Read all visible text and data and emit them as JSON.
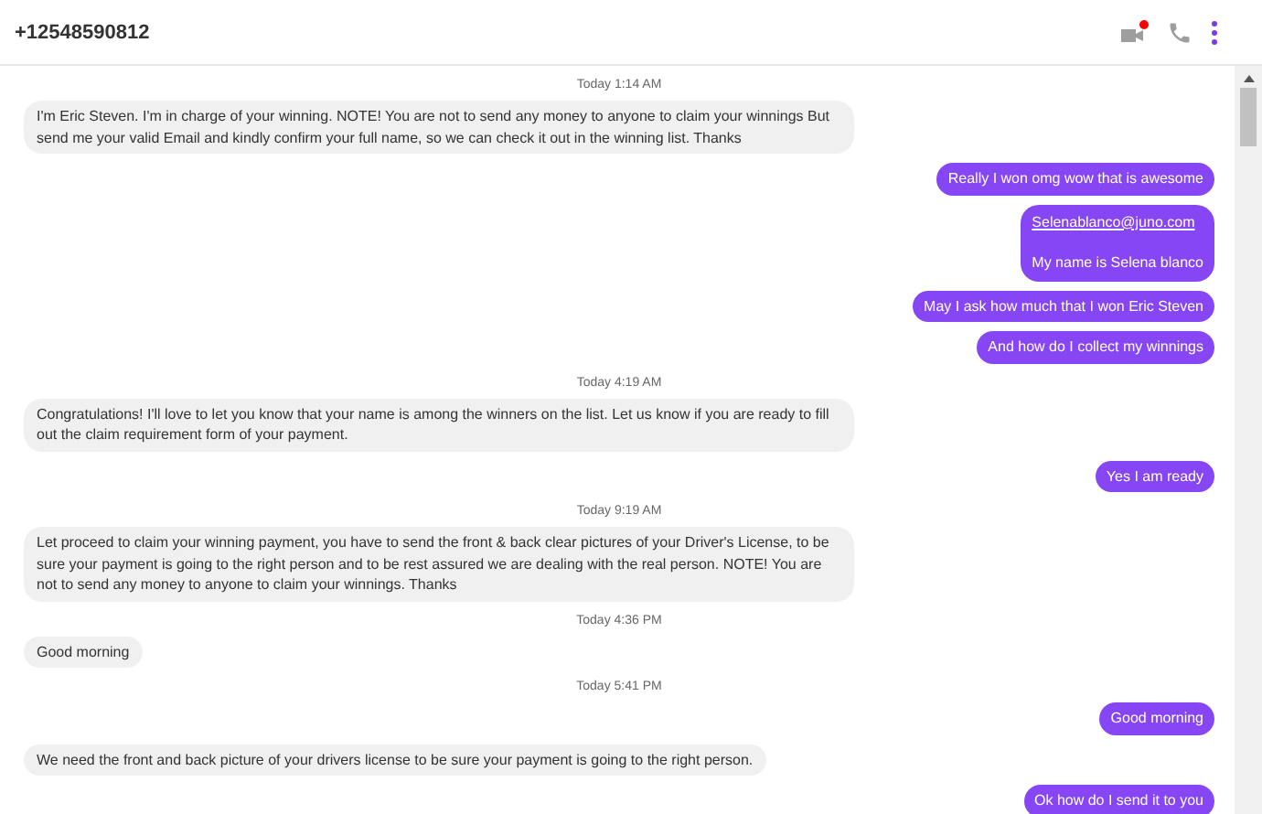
{
  "header": {
    "title": "+12548590812",
    "video_notification": true
  },
  "messages": [
    {
      "kind": "time",
      "text": "Today 1:14 AM"
    },
    {
      "kind": "in",
      "text": "I'm Eric Steven. I'm in charge of your winning. NOTE! You are not to send any money to anyone to claim your winnings But send me your valid Email and kindly confirm your full name, so we can check it out in the winning list. Thanks"
    },
    {
      "kind": "out",
      "text": "Really I won omg wow that is awesome"
    },
    {
      "kind": "out",
      "link": "Selenablanco@juno.com",
      "text": "My name is Selena blanco"
    },
    {
      "kind": "out",
      "text": "May I ask how much that I won Eric Steven"
    },
    {
      "kind": "out",
      "text": "And how do I collect my winnings"
    },
    {
      "kind": "time",
      "text": "Today 4:19 AM"
    },
    {
      "kind": "in",
      "text": "Congratulations! I'll love to let you know that your name  is among the winners on the list. Let us know if you are ready to fill out the claim requirement form of your payment."
    },
    {
      "kind": "out",
      "text": "Yes I am ready"
    },
    {
      "kind": "time",
      "text": "Today 9:19 AM"
    },
    {
      "kind": "in",
      "text": "Let proceed to claim your winning payment, you have to send the front & back clear pictures of your Driver's License, to be sure your payment is going to the right person and to be rest assured we are dealing with the real person. NOTE! You are not to send any money to anyone to claim your winnings. Thanks"
    },
    {
      "kind": "time",
      "text": "Today 4:36 PM"
    },
    {
      "kind": "in",
      "text": "Good morning"
    },
    {
      "kind": "time",
      "text": "Today 5:41 PM"
    },
    {
      "kind": "out",
      "text": "Good morning"
    },
    {
      "kind": "in",
      "text": "We need the front and back picture of your drivers license to be sure your payment is going to the right person."
    },
    {
      "kind": "out",
      "text": "Ok how do I send it to you"
    }
  ]
}
